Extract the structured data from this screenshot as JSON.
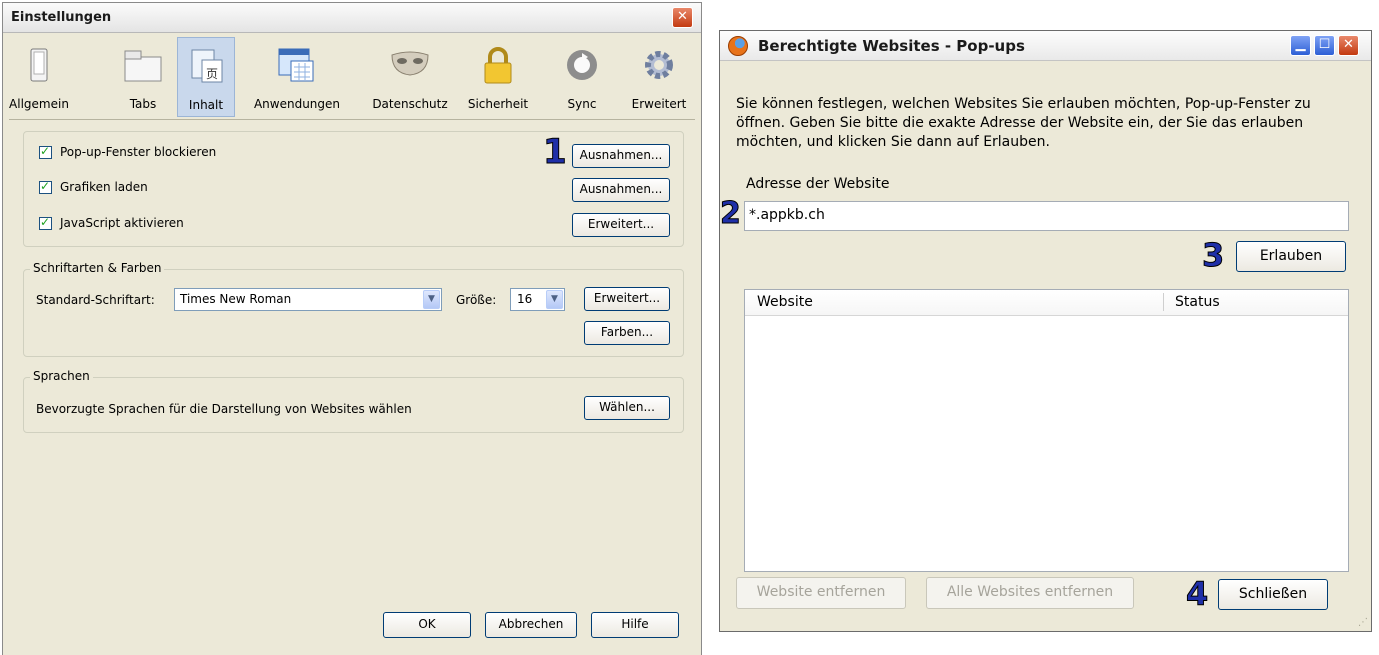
{
  "settings": {
    "title": "Einstellungen",
    "tabs": [
      {
        "label": "Allgemein",
        "icon": "switch-icon"
      },
      {
        "label": "Tabs",
        "icon": "tabs-icon"
      },
      {
        "label": "Inhalt",
        "icon": "content-icon"
      },
      {
        "label": "Anwendungen",
        "icon": "applications-icon"
      },
      {
        "label": "Datenschutz",
        "icon": "mask-icon"
      },
      {
        "label": "Sicherheit",
        "icon": "lock-icon"
      },
      {
        "label": "Sync",
        "icon": "sync-icon"
      },
      {
        "label": "Erweitert",
        "icon": "gear-icon"
      }
    ],
    "selected_tab": "Inhalt",
    "content": {
      "popup_label": "Pop-up-Fenster blockieren",
      "popup_checked": true,
      "images_label": "Grafiken laden",
      "images_checked": true,
      "js_label": "JavaScript aktivieren",
      "js_checked": true,
      "exceptions_button": "Ausnahmen...",
      "exceptions_button2": "Ausnahmen...",
      "advanced_button": "Erweitert..."
    },
    "fonts": {
      "group_label": "Schriftarten & Farben",
      "default_font_label": "Standard-Schriftart:",
      "default_font_value": "Times New Roman",
      "size_label": "Größe:",
      "size_value": "16",
      "advanced_button": "Erweitert...",
      "colors_button": "Farben..."
    },
    "languages": {
      "group_label": "Sprachen",
      "description": "Bevorzugte Sprachen für die Darstellung von Websites wählen",
      "choose_button": "Wählen..."
    },
    "footer": {
      "ok": "OK",
      "cancel": "Abbrechen",
      "help": "Hilfe"
    }
  },
  "popups": {
    "title": "Berechtigte Websites - Pop-ups",
    "description": "Sie können festlegen, welchen Websites Sie erlauben möchten, Pop-up-Fenster zu öffnen. Geben Sie bitte die exakte Adresse der Website ein, der Sie das erlauben möchten, und klicken Sie dann auf Erlauben.",
    "address_label": "Adresse der Website",
    "address_value": "*.appkb.ch",
    "allow_button": "Erlauben",
    "columns": [
      "Website",
      "Status"
    ],
    "remove_button": "Website entfernen",
    "remove_all_button": "Alle Websites entfernen",
    "close_button": "Schließen"
  },
  "annotations": [
    "1",
    "2",
    "3",
    "4"
  ],
  "colors": {
    "window_bg": "#ece9d8",
    "selected_tab_bg": "#c9d8ec",
    "close_red": "#c33a10",
    "annotation_blue": "#1f2fa8"
  }
}
